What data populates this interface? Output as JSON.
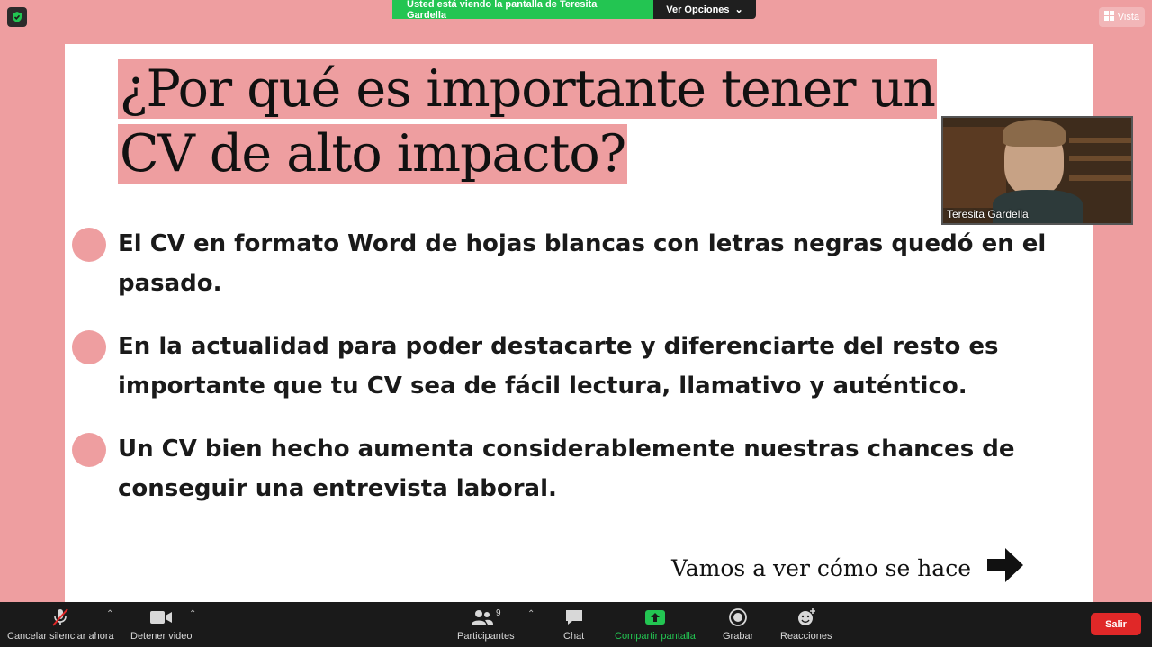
{
  "top": {
    "sharing_banner": "Usted está viendo la pantalla de Teresita Gardella",
    "view_options": "Ver Opciones",
    "view_label": "Vista"
  },
  "slide": {
    "title_line1": "¿Por qué es importante tener un",
    "title_line2": "CV de alto impacto?",
    "bullets": [
      "El CV en formato Word de hojas blancas con letras negras quedó en el pasado.",
      "En la actualidad para poder destacarte y diferenciarte del resto es importante que tu CV sea de fácil lectura, llamativo y auténtico.",
      "Un CV bien hecho aumenta considerablemente nuestras chances de conseguir una entrevista laboral."
    ],
    "footer": "Vamos a ver cómo se hace"
  },
  "webcam": {
    "participant_name": "Teresita Gardella"
  },
  "toolbar": {
    "mute": "Cancelar silenciar ahora",
    "video": "Detener video",
    "participants": "Participantes",
    "participants_count": "9",
    "chat": "Chat",
    "share": "Compartir pantalla",
    "record": "Grabar",
    "reactions": "Reacciones",
    "leave": "Salir"
  },
  "colors": {
    "accent_pink": "#ee9ea0",
    "share_green": "#23c552",
    "leave_red": "#e02828"
  }
}
